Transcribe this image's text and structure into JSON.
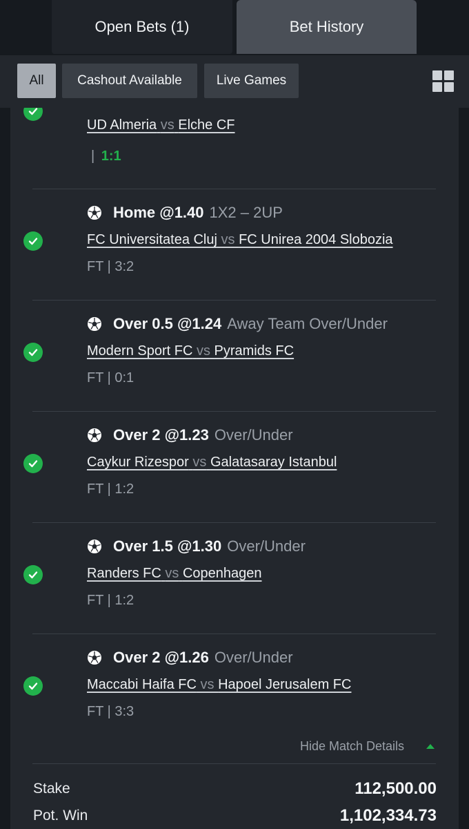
{
  "tabs": [
    {
      "label": "Open Bets (1)"
    },
    {
      "label": "Bet History"
    }
  ],
  "filters": [
    {
      "label": "All"
    },
    {
      "label": "Cashout Available"
    },
    {
      "label": "Live Games"
    }
  ],
  "colors": {
    "win_check": "#22b14c",
    "live_score": "#22b14c"
  },
  "first_selection": {
    "home": "UD Almeria",
    "vs": "vs",
    "away": "Elche CF",
    "score_sep": "|",
    "score": "1:1"
  },
  "selections": [
    {
      "pick": "Home @1.40",
      "market": "1X2  –  2UP",
      "home": "FC Universitatea Cluj",
      "vs": "vs",
      "away": "FC Unirea 2004 Slobozia",
      "result": "FT | 3:2"
    },
    {
      "pick": "Over 0.5 @1.24",
      "market": "Away Team Over/Under",
      "home": "Modern Sport FC",
      "vs": "vs",
      "away": "Pyramids FC",
      "result": "FT | 0:1"
    },
    {
      "pick": "Over 2 @1.23",
      "market": "Over/Under",
      "home": "Caykur Rizespor",
      "vs": "vs",
      "away": "Galatasaray Istanbul",
      "result": "FT | 1:2"
    },
    {
      "pick": "Over 1.5 @1.30",
      "market": "Over/Under",
      "home": "Randers FC",
      "vs": "vs",
      "away": "Copenhagen",
      "result": "FT | 1:2"
    },
    {
      "pick": "Over 2 @1.26",
      "market": "Over/Under",
      "home": "Maccabi Haifa FC",
      "vs": "vs",
      "away": "Hapoel Jerusalem FC",
      "result": "FT | 3:3"
    }
  ],
  "details_toggle": "Hide Match Details",
  "totals": {
    "stake_label": "Stake",
    "stake_value": "112,500.00",
    "win_label": "Pot. Win",
    "win_value": "1,102,334.73"
  }
}
